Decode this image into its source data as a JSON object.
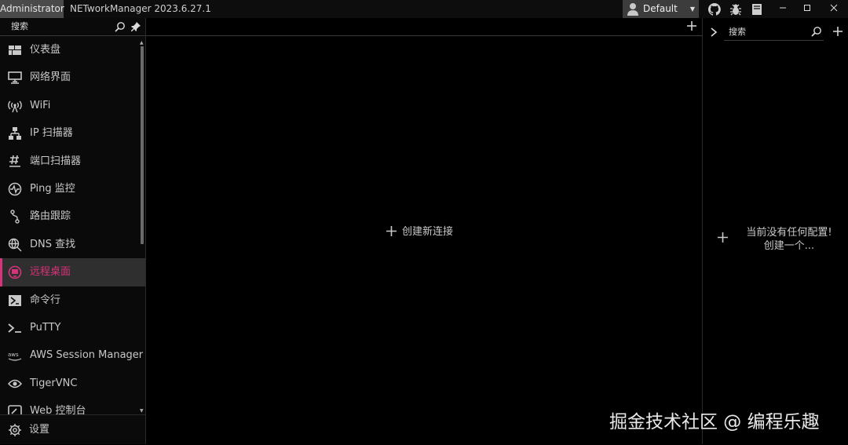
{
  "titlebar": {
    "admin_label": "Administrator",
    "app_title": "NETworkManager 2023.6.27.1",
    "profile_label": "Default",
    "icons": [
      "github-icon",
      "bug-icon",
      "document-icon"
    ],
    "window_buttons": [
      "minimize",
      "maximize",
      "close"
    ]
  },
  "sidebar": {
    "search_placeholder": "搜索",
    "items": [
      {
        "label": "仪表盘",
        "icon": "dashboard-icon"
      },
      {
        "label": "网络界面",
        "icon": "network-interface-icon"
      },
      {
        "label": "WiFi",
        "icon": "wifi-icon"
      },
      {
        "label": "IP 扫描器",
        "icon": "ip-scanner-icon"
      },
      {
        "label": "端口扫描器",
        "icon": "port-scanner-icon"
      },
      {
        "label": "Ping 监控",
        "icon": "ping-monitor-icon"
      },
      {
        "label": "路由跟踪",
        "icon": "traceroute-icon"
      },
      {
        "label": "DNS 查找",
        "icon": "dns-lookup-icon"
      },
      {
        "label": "远程桌面",
        "icon": "remote-desktop-icon",
        "active": true
      },
      {
        "label": "命令行",
        "icon": "powershell-icon"
      },
      {
        "label": "PuTTY",
        "icon": "terminal-icon"
      },
      {
        "label": "AWS Session Manager",
        "icon": "aws-icon"
      },
      {
        "label": "TigerVNC",
        "icon": "eye-icon"
      },
      {
        "label": "Web 控制台",
        "icon": "web-console-icon"
      }
    ],
    "settings_label": "设置"
  },
  "main": {
    "create_connection_label": "创建新连接"
  },
  "profiles_panel": {
    "search_placeholder": "搜索",
    "empty_line1": "当前没有任何配置!",
    "empty_line2": "创建一个..."
  },
  "watermark": "掘金技术社区 @ 编程乐趣",
  "colors": {
    "accent": "#d6337a",
    "background": "#000000",
    "selected_bg": "#2f2f2f"
  }
}
